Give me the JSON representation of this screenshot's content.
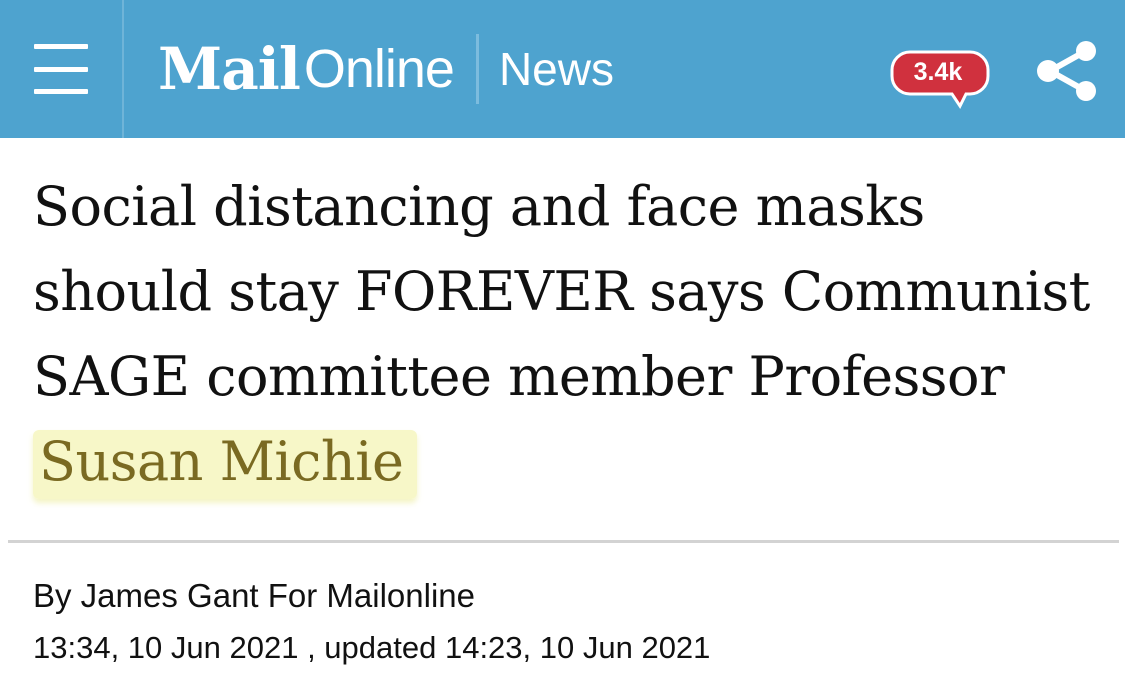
{
  "header": {
    "brand_mail": "Mail",
    "brand_online": "Online",
    "section": "News",
    "comments_count": "3.4k",
    "background_color": "#4ea3cf",
    "badge_color": "#d0313e",
    "icons": [
      "hamburger-menu-icon",
      "comment-bubble-icon",
      "share-icon"
    ]
  },
  "article": {
    "headline_main": "Social distancing and face masks should stay FOREVER says Communist SAGE committee member Professor ",
    "headline_highlight": "Susan Michie",
    "highlight_color": "#f7f7c8",
    "byline": "By James Gant For Mailonline",
    "dateline": "13:34, 10 Jun 2021 , updated 14:23, 10 Jun 2021"
  }
}
